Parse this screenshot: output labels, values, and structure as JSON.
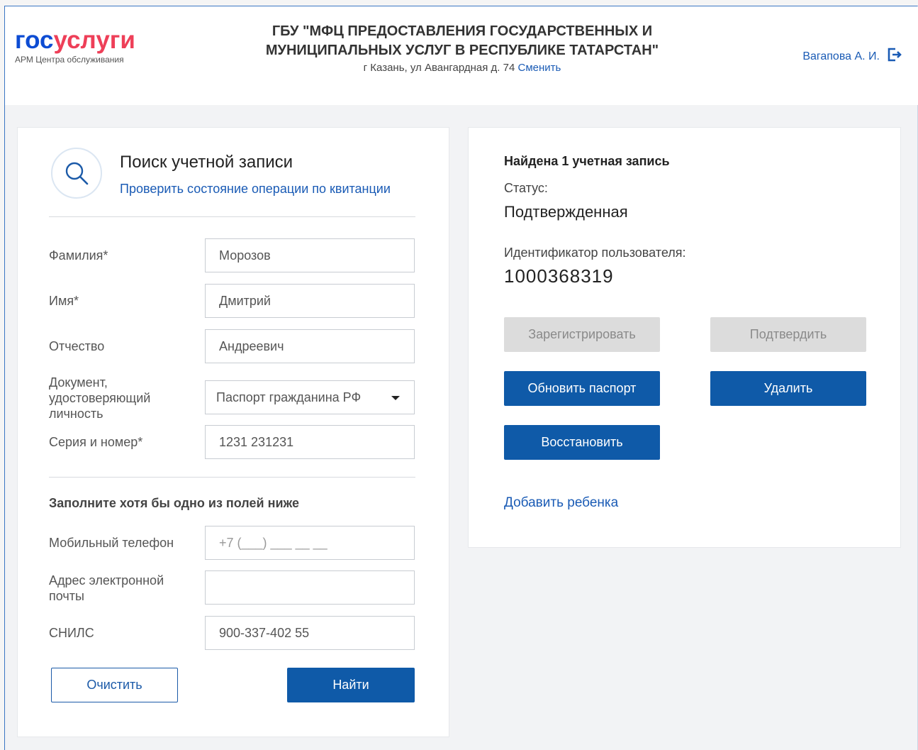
{
  "header": {
    "logo_part1": "гос",
    "logo_part2": "услуги",
    "logo_subtitle": "АРМ Центра обслуживания",
    "org_title_line1": "ГБУ \"МФЦ ПРЕДОСТАВЛЕНИЯ ГОСУДАРСТВЕННЫХ И",
    "org_title_line2": "МУНИЦИПАЛЬНЫХ УСЛУГ В РЕСПУБЛИКЕ ТАТАРСТАН\"",
    "org_address": "г Казань, ул Авангардная д. 74",
    "change_link": "Сменить",
    "user_name": "Вагапова А. И."
  },
  "search": {
    "title": "Поиск учетной записи",
    "check_link": "Проверить состояние операции по квитанции",
    "fields": {
      "surname": {
        "label": "Фамилия*",
        "value": "Морозов"
      },
      "name": {
        "label": "Имя*",
        "value": "Дмитрий"
      },
      "patronymic": {
        "label": "Отчество",
        "value": "Андреевич"
      },
      "document": {
        "label_line1": "Документ,",
        "label_line2": "удостоверяющий",
        "label_line3": "личность",
        "value": "Паспорт гражданина РФ"
      },
      "series": {
        "label": "Серия и номер*",
        "value": "1231 231231"
      }
    },
    "section_title": "Заполните хотя бы одно из полей ниже",
    "optional": {
      "phone": {
        "label": "Мобильный телефон",
        "placeholder": "+7 (___) ___ __ __"
      },
      "email": {
        "label_line1": "Адрес электронной",
        "label_line2": "почты",
        "value": ""
      },
      "snils": {
        "label": "СНИЛС",
        "value": "900-337-402 55"
      }
    },
    "clear_button": "Очистить",
    "find_button": "Найти"
  },
  "result": {
    "found": "Найдена 1 учетная запись",
    "status_label": "Статус:",
    "status_value": "Подтвержденная",
    "id_label": "Идентификатор пользователя:",
    "id_value": "1000368319",
    "buttons": {
      "register": "Зарегистрировать",
      "confirm": "Подтвердить",
      "update_passport": "Обновить паспорт",
      "delete": "Удалить",
      "restore": "Восстановить"
    },
    "add_child_link": "Добавить ребенка"
  },
  "colors": {
    "accent": "#0f5aa8",
    "link": "#1a5bb5",
    "logo_blue": "#0d4cd3",
    "logo_red": "#ee3f58",
    "disabled": "#dcdcdc"
  }
}
